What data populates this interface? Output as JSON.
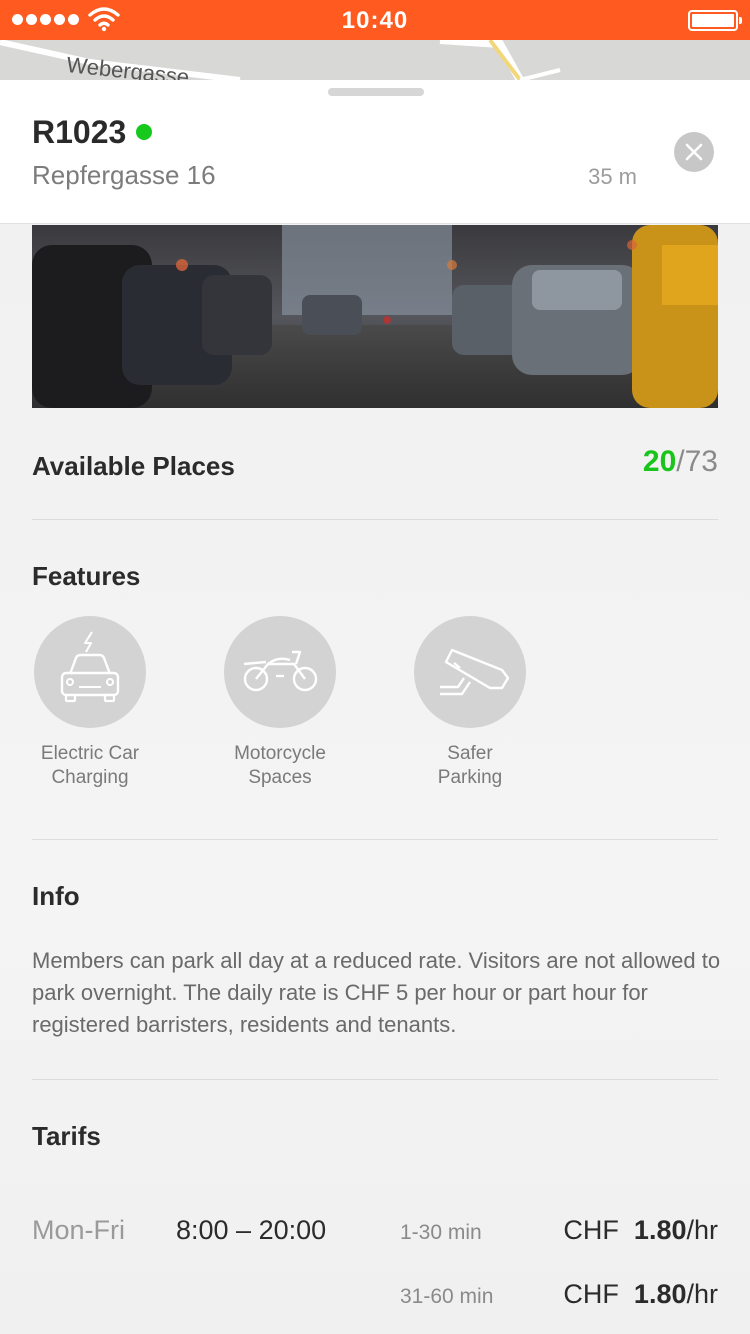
{
  "status_bar": {
    "time": "10:40",
    "signal_dots": 5,
    "wifi_icon": "wifi-icon",
    "battery_icon": "battery-icon"
  },
  "map": {
    "street_label": "Webergasse"
  },
  "header": {
    "spot_id": "R1023",
    "status_color": "#17c91d",
    "address": "Repfergasse 16",
    "distance": "35 m"
  },
  "places": {
    "label": "Available Places",
    "available": "20",
    "separator": "/",
    "total": "73"
  },
  "features": {
    "title": "Features",
    "items": [
      {
        "icon": "electric-car-icon",
        "line1": "Electric Car",
        "line2": "Charging"
      },
      {
        "icon": "motorcycle-icon",
        "line1": "Motorcycle",
        "line2": "Spaces"
      },
      {
        "icon": "security-camera-icon",
        "line1": "Safer",
        "line2": "Parking"
      }
    ]
  },
  "info": {
    "title": "Info",
    "text": "Members can park all day at a reduced rate. Visitors are not allowed to park overnight. The daily rate is CHF 5 per hour or part hour for registered barristers, residents and tenants."
  },
  "tariffs": {
    "title": "Tarifs",
    "rows": [
      {
        "days": "Mon-Fri",
        "hours": "8:00 – 20:00",
        "range": "1-30 min",
        "currency": "CHF",
        "amount": "1.80",
        "unit": "/hr"
      },
      {
        "days": "",
        "hours": "",
        "range": "31-60 min",
        "currency": "CHF",
        "amount": "1.80",
        "unit": "/hr"
      }
    ]
  },
  "colors": {
    "brand": "#ff5a1f",
    "available": "#19c51b"
  }
}
